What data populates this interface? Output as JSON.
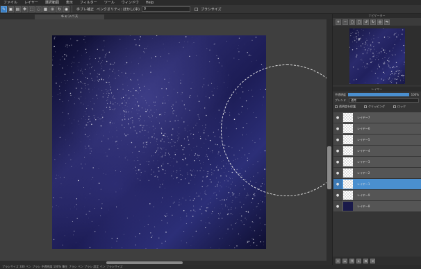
{
  "menu": [
    "ファイル",
    "レイヤー",
    "選択範囲",
    "表示",
    "フィルター",
    "ツール",
    "ウィンドウ",
    "Help"
  ],
  "toolbar": {
    "buttons": [
      "pen-tool",
      "brush-tool",
      "eraser-tool",
      "move-tool",
      "select-tool",
      "lasso-tool",
      "fill-tool",
      "eyedropper-tool",
      "rotate-tool",
      "hand-tool"
    ],
    "brush_label": "手ブレ補正",
    "brush_value": "ペンクオリティ: ぼかし(中)",
    "brush_option": "0",
    "check_label": "ブラシサイズ"
  },
  "doc_tab": {
    "label": "キャンバス"
  },
  "navigator": {
    "title": "ナビゲーター",
    "tools": [
      "zoom-in-icon",
      "zoom-out-icon",
      "fit-icon",
      "actual-size-icon",
      "rotate-left-icon",
      "rotate-right-icon",
      "reset-icon",
      "flip-icon"
    ]
  },
  "layers": {
    "title": "レイヤー",
    "opacity_label": "不透明度",
    "opacity_value": "100%",
    "opacity_fraction": 1.0,
    "blend_label": "ブレンド",
    "blend_value": "通常",
    "protect_label": "透明度を保護",
    "clipping_label": "クリッピング",
    "lock_label": "ロック",
    "items": [
      {
        "name": "レイヤー7",
        "selected": false,
        "dark": false
      },
      {
        "name": "レイヤー6",
        "selected": false,
        "dark": false
      },
      {
        "name": "レイヤー5",
        "selected": false,
        "dark": false
      },
      {
        "name": "レイヤー4",
        "selected": false,
        "dark": false
      },
      {
        "name": "レイヤー3",
        "selected": false,
        "dark": false
      },
      {
        "name": "レイヤー2",
        "selected": false,
        "dark": false
      },
      {
        "name": "レイヤー1",
        "selected": true,
        "dark": false
      },
      {
        "name": "レイヤー9",
        "selected": false,
        "dark": false
      },
      {
        "name": "レイヤー8",
        "selected": false,
        "dark": true
      }
    ]
  },
  "status": {
    "text": "ブラシサイズ 330 ペン ブラシ 不透明度 100% 筆圧 ブラシ ペン ブラシ 設定 ペン ブラシサイズ"
  },
  "colors": {
    "accent": "#4a8fcf",
    "canvas_bg": "#0d0d30",
    "panel_bg": "#353535"
  }
}
